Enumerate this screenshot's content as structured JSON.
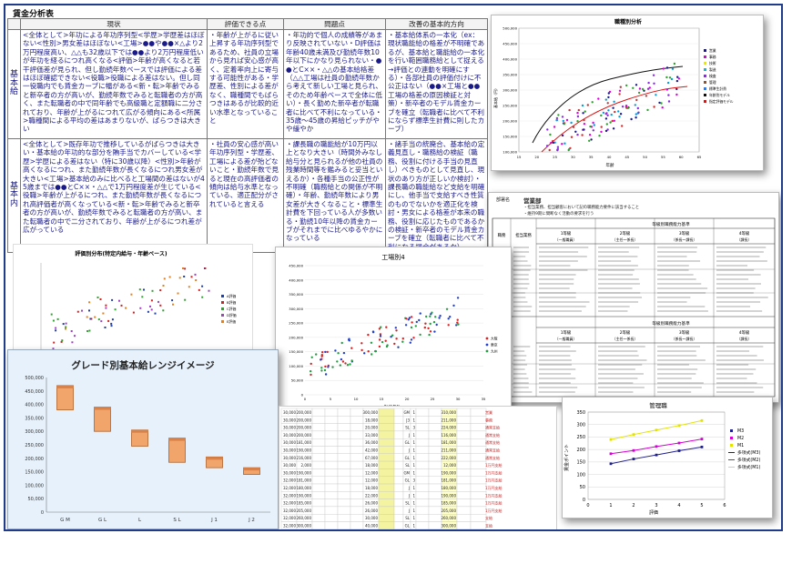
{
  "analysis_table": {
    "title": "賃金分析表",
    "columns": [
      "現状",
      "評価できる点",
      "問題点",
      "改善の基本的方向"
    ],
    "rows": [
      {
        "label": "基本給",
        "cells": [
          "<全体として>年功による年功序列型<学歴>学歴差はほぼない<性別>男女差はほぼない<工場>●●や●●×△より2万円程度高い、△△も32歳以下では●●より2万円程度低いが年功を経るにつれ高くなる<評価>年齢が高くなると若干評価差が見られ、但し勤続年数ベースでは評価による差はほぼ確認できない<役職>役職による差はない。但し同一役職内でも賃金カーブに幅がある<新・転>年齢でみると新卒者の方が高いが、勤続年数でみると転職者の方が高く、また転職者の中で同年齢でも高級職と定額職に二分されており、年齢が上がるにつれて広がる傾向にある<所属>職種間による平均の差はあまりないが、ばらつきは大きい",
          "・年齢が上がるに従い上昇する年功序列型であるため、社員の立場から見れば安心感が高く、定着率向上に寄与する可能性がある・学歴差、性別による差がなく、職種間でもばらつきはあるが比較的近い水準となっていること",
          "・年功的で個人の成績等があまり反映されていない・D評価は年齢40歳未満及び勤続年数10年以下にかなり見られない・●●とC××・△△の基本給格差（△△工場は社員の勤続年数から考えて新しい工場と見られ、そのため年齢ベースで全体に低い）・長く勤めた新卒者が転職者に比べて不利になっている・35歳〜45歳の昇給ピッチがやや緩やか",
          "・基本給体系の一本化（ex：現状職能給の格差が不明確であるが、基本給と職能給の一本化を行い範囲職務給として捉える→評価との連動を明確にする）・各部社員の評価付けに不公正はない（●●×工場と●●工場の格差の原因検証と対策）・新卒者のモデル賃金カーブを確立（転職者に比べて不利にならず標準生計費に則したカーブ）"
        ]
      },
      {
        "label": "基本内",
        "cells": [
          "<全体として>既存年功で推移しているがばらつきは大きい・基本給の年功的な部分を賄手当でカバーしている<学歴>学歴による差はない（特に30歳以降）<性別>年齢が高くなるにつれ、また勤続年数が長くなるにつれ男女差が大きい<工場>基本給のみに比べると工場間の差はないが45歳までは●●とC××・△△で1万円程度差が生じている<役職>年齢が上がるにつれ、また勤続年数が長くなるにつれ高評価者が高くなっている<新・転>年齢でみると新卒者の方が高いが、勤続年数でみると転職者の方が高い、また転職者の中で二分されており、年齢が上がるにつれ差が広がっている",
          "・社員の安心感が高い年功序列型・学歴差、工場による差が殆どないこと・勤続年数で見ると現在の高評価者の傾向は給与水準となっている、適正配分がされていると言える",
          "・課長職の職能給が10万円以上となり大きい（時間外みなし給与分と見られるが他の社員の残業時間等を鑑みると妥当といえるか）・各種手当の公正性が不明確（職務給との関係が不明確）・年齢、勤続年数により男女差が大きくなること・標準生計費を下回っている人が多数いる・勤続10年以降の賃金カーブがそれまでに比べゆるやかになっている",
          "・諸手当の統廃合、基本給の定義見直し・職務給の検証（職務、役割に付ける手当の見直し）ベきものとして見直し、現状のあり方が正しいか検討）・課長職の職能給など支給を明確にし、他手当で支給すべき性質のものでないかを適正化を検討・男女による格差が本来の職務、役割に応じたものであるかの検証・新卒者のモデル賃金カーブを確立（転職者に比べて不利になる場合があるか）"
        ]
      }
    ]
  },
  "scatter_age": {
    "title": "職種別分析",
    "ylabel": "基本給（円）",
    "xlabel": "年齢",
    "y_ticks": [
      "500,000",
      "450,000",
      "400,000",
      "350,000",
      "300,000",
      "250,000",
      "200,000",
      "150,000",
      "100,000"
    ],
    "x_ticks": [
      "15",
      "20",
      "25",
      "30",
      "35",
      "40",
      "45",
      "50",
      "55",
      "60",
      "65"
    ],
    "legend": [
      "営業",
      "事務",
      "技術",
      "製造",
      "検査",
      "管理",
      "標準生計費",
      "年齢別モデル",
      "指定評価モデル"
    ]
  },
  "grade_sheet": {
    "dept_label": "部署名",
    "dept_value": "営業部",
    "notes": [
      "・担当業務、担当顧客において記の職務能力要件に該当すること",
      "・維持9期に間断なく活動の要求を行う"
    ],
    "title_main": "等級別職務能力基準",
    "grades": [
      "1等級",
      "2等級",
      "3等級",
      "4等級"
    ],
    "grade_subs": [
      "（一般職員）",
      "（主任〜係長）",
      "（係長〜課長）",
      "（課長）"
    ],
    "row_labels": [
      "職務",
      "職能",
      "職務",
      "職能"
    ],
    "row_titles": [
      "担当業務",
      "担当業務",
      "職能要件",
      "職能要件"
    ]
  },
  "chart_eval": {
    "title": "評価別分布(特定内給与・年齢ベース)",
    "legend": [
      "A評価",
      "B評価",
      "C評価",
      "D評価",
      "E評価"
    ]
  },
  "chart_factory": {
    "title": "工場別4",
    "xlabel": "勤続年数",
    "y_ticks": [
      "450,000",
      "400,000",
      "350,000",
      "300,000",
      "250,000",
      "200,000",
      "150,000",
      "100,000",
      "50,000",
      "0"
    ],
    "x_ticks": [
      "0",
      "5",
      "10",
      "15",
      "20",
      "25",
      "30",
      "35"
    ],
    "legend": [
      "大阪",
      "東京",
      "九州"
    ]
  },
  "chart_grade": {
    "title": "グレード別基本給レンジイメージ",
    "y_ticks": [
      "500,000",
      "450,000",
      "400,000",
      "350,000",
      "300,000",
      "250,000",
      "200,000",
      "150,000",
      "100,000",
      "50,000",
      "0"
    ],
    "categories": [
      "G M",
      "G L",
      "L",
      "S L",
      "J 1",
      "J 2"
    ],
    "ranges": [
      [
        380000,
        470000
      ],
      [
        300000,
        390000
      ],
      [
        245000,
        305000
      ],
      [
        185000,
        275000
      ],
      [
        165000,
        205000
      ],
      [
        140000,
        165000
      ]
    ]
  },
  "spreadsheet": {
    "rows": [
      [
        "30,000",
        "200,000",
        "",
        "",
        "",
        "",
        "300,000",
        "",
        "",
        "GM",
        "1",
        "",
        "",
        "310,000",
        "",
        "営業"
      ],
      [
        "30,000",
        "200,000",
        "",
        "",
        "",
        "",
        "18,000",
        "",
        "",
        "J3",
        "1",
        "",
        "",
        "211,000",
        "",
        "事務"
      ],
      [
        "30,000",
        "200,000",
        "",
        "",
        "",
        "",
        "20,000",
        "",
        "",
        "SL",
        "3",
        "",
        "",
        "224,000",
        "",
        "通常支給"
      ],
      [
        "30,000",
        "200,000",
        "",
        "",
        "",
        "",
        "33,000",
        "",
        "",
        "J",
        "1",
        "",
        "",
        "116,000",
        "",
        "通常支給"
      ],
      [
        "30,000",
        "181,000",
        "",
        "",
        "",
        "",
        "36,000",
        "",
        "",
        "GL",
        "1",
        "",
        "",
        "181,000",
        "",
        "通常支給"
      ],
      [
        "30,000",
        "190,000",
        "",
        "",
        "",
        "",
        "42,000",
        "",
        "",
        "J",
        "1",
        "",
        "",
        "211,000",
        "",
        "通常支給"
      ],
      [
        "30,000",
        "216,000",
        "",
        "",
        "",
        "",
        "67,000",
        "",
        "",
        "GL",
        "1",
        "",
        "",
        "222,000",
        "",
        "通常支給"
      ],
      [
        "30,000",
        "2,000",
        "",
        "",
        "",
        "",
        "18,000",
        "",
        "",
        "SL",
        "1",
        "",
        "",
        "12,000",
        "",
        "1万円支給"
      ],
      [
        "30,000",
        "190,000",
        "",
        "",
        "",
        "",
        "12,000",
        "",
        "",
        "GM",
        "1",
        "",
        "",
        "190,000",
        "",
        "1万円支給"
      ],
      [
        "32,000",
        "181,000",
        "",
        "",
        "",
        "",
        "12,000",
        "",
        "",
        "GL",
        "3",
        "",
        "",
        "181,000",
        "",
        "1万円支給"
      ],
      [
        "32,000",
        "180,000",
        "",
        "",
        "",
        "",
        "18,000",
        "",
        "",
        "J",
        "1",
        "",
        "",
        "180,000",
        "",
        "1万円支給"
      ],
      [
        "32,000",
        "190,000",
        "",
        "",
        "",
        "",
        "22,000",
        "",
        "",
        "J",
        "1",
        "",
        "",
        "190,000",
        "",
        "1万円支給"
      ],
      [
        "32,000",
        "185,000",
        "",
        "",
        "",
        "",
        "26,000",
        "",
        "",
        "SL",
        "1",
        "",
        "",
        "185,000",
        "",
        "1万円支給"
      ],
      [
        "32,000",
        "205,000",
        "",
        "",
        "",
        "",
        "26,000",
        "",
        "",
        "J",
        "1",
        "",
        "",
        "205,000",
        "",
        "1万円支給"
      ],
      [
        "32,000",
        "260,000",
        "",
        "",
        "",
        "",
        "30,000",
        "",
        "",
        "SL",
        "1",
        "",
        "",
        "260,000",
        "",
        "支給"
      ],
      [
        "32,000",
        "300,000",
        "",
        "",
        "",
        "",
        "40,000",
        "",
        "",
        "GL",
        "1",
        "",
        "",
        "300,000",
        "",
        "支給"
      ]
    ]
  },
  "chart_mgmt": {
    "title": "管理職",
    "ylabel": "賃金ポイント",
    "xlabel": "評価",
    "y_ticks": [
      "350",
      "300",
      "250",
      "200",
      "150",
      "100",
      "50",
      "0"
    ],
    "x_ticks": [
      "0",
      "1",
      "2",
      "3",
      "4",
      "5",
      "6"
    ],
    "legend": [
      "M3",
      "M2",
      "M1",
      "多項式(M3)",
      "多項式(M2)",
      "多項式(M1)"
    ],
    "series": [
      {
        "name": "M3",
        "color": "#1f1f8c",
        "values": [
          [
            1,
            143
          ],
          [
            2,
            162
          ],
          [
            3,
            178
          ],
          [
            4,
            195
          ],
          [
            5,
            210
          ]
        ]
      },
      {
        "name": "M2",
        "color": "#d400d4",
        "values": [
          [
            1,
            183
          ],
          [
            2,
            196
          ],
          [
            3,
            212
          ],
          [
            4,
            226
          ],
          [
            5,
            242
          ]
        ]
      },
      {
        "name": "M1",
        "color": "#e3e300",
        "values": [
          [
            1,
            240
          ],
          [
            2,
            260
          ],
          [
            3,
            278
          ],
          [
            4,
            296
          ],
          [
            5,
            316
          ]
        ]
      }
    ]
  }
}
